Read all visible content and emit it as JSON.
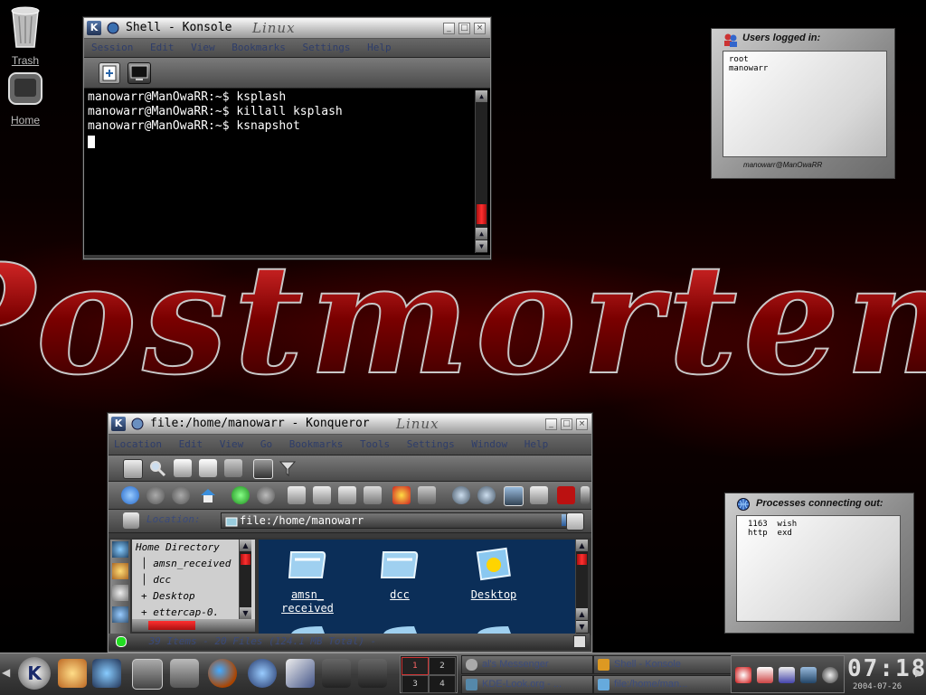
{
  "desktop": {
    "icons": [
      {
        "label": "Trash",
        "icon": "trash-icon"
      },
      {
        "label": "Home",
        "icon": "home-icon"
      }
    ]
  },
  "konsole": {
    "title": "Shell - Konsole",
    "title_logo": "Linux",
    "menu": [
      "Session",
      "Edit",
      "View",
      "Bookmarks",
      "Settings",
      "Help"
    ],
    "lines": [
      "manowarr@ManOwaRR:~$ ksplash",
      "manowarr@ManOwaRR:~$ killall ksplash",
      "manowarr@ManOwaRR:~$ ksnapshot"
    ]
  },
  "users_widget": {
    "title": "Users logged in:",
    "users": [
      "root",
      "manowarr"
    ],
    "footer": "manowarr@ManOwaRR"
  },
  "processes_widget": {
    "title": "Processes connecting out:",
    "rows": [
      {
        "pid": "1163",
        "name": "wish"
      },
      {
        "pid": "http",
        "name": "exd"
      }
    ]
  },
  "konqueror": {
    "title": "file:/home/manowarr - Konqueror",
    "title_logo": "Linux",
    "menu": [
      "Location",
      "Edit",
      "View",
      "Go",
      "Bookmarks",
      "Tools",
      "Settings",
      "Window",
      "Help"
    ],
    "location_label": "Location:",
    "location_value": "file:/home/manowarr",
    "tree": [
      {
        "label": "Home Directory",
        "prefix": ""
      },
      {
        "label": "amsn_received",
        "prefix": "│ "
      },
      {
        "label": "dcc",
        "prefix": "│ "
      },
      {
        "label": "Desktop",
        "prefix": "+ "
      },
      {
        "label": "ettercap-0.",
        "prefix": "+ "
      }
    ],
    "files": [
      {
        "label": "amsn_ received",
        "icon": "folder-icon"
      },
      {
        "label": "dcc",
        "icon": "folder-icon"
      },
      {
        "label": "Desktop",
        "icon": "desktop-folder-icon"
      }
    ],
    "status": "39 Items - 20 Files (124.1 MB Total) - "
  },
  "taskbar": {
    "pager": [
      "1",
      "2",
      "3",
      "4"
    ],
    "tasks": [
      {
        "label": "al's Messenger",
        "icon": "messenger-icon"
      },
      {
        "label": "Shell - Konsole",
        "icon": "konsole-icon"
      },
      {
        "label": "KDE-Look.org - ...",
        "icon": "browser-icon"
      },
      {
        "label": "file:/home/man...",
        "icon": "konqueror-icon"
      }
    ],
    "clock": "07:18",
    "date": "2004-07-26"
  },
  "wallpaper": {
    "text": "Postmortem",
    "accent": "#8b0000"
  }
}
